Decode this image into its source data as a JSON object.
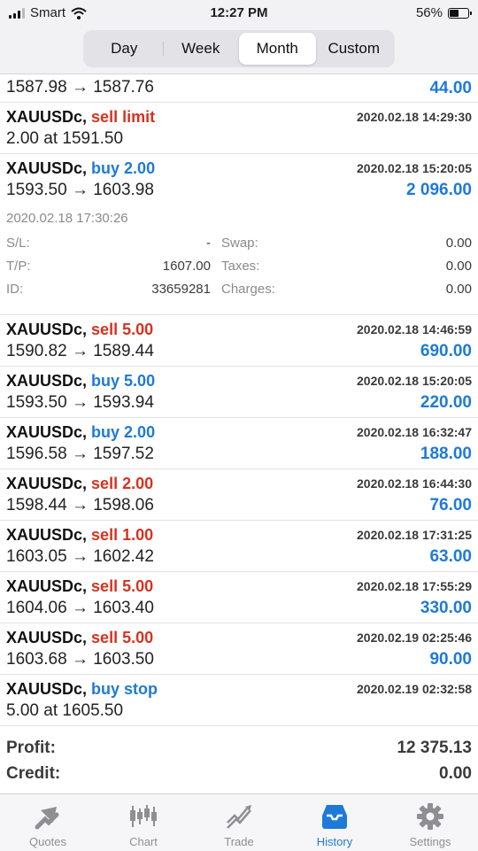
{
  "status_bar": {
    "carrier": "Smart",
    "time": "12:27 PM",
    "battery": "56%",
    "battery_level": 0.56
  },
  "period_tabs": [
    {
      "label": "Day",
      "active": false
    },
    {
      "label": "Week",
      "active": false
    },
    {
      "label": "Month",
      "active": true
    },
    {
      "label": "Custom",
      "active": false
    }
  ],
  "top_row": {
    "prices": "1587.98 → 1587.76",
    "profit": "44.00"
  },
  "orders": [
    {
      "symbol": "XAUUSDc,",
      "side": "sell limit",
      "dir": "sell",
      "time": "2020.02.18 14:29:30",
      "line2": "2.00 at 1591.50",
      "profit": ""
    },
    {
      "symbol": "XAUUSDc,",
      "side": "buy 2.00",
      "dir": "buy",
      "time": "2020.02.18 15:20:05",
      "line2": "1593.50 → 1603.98",
      "profit": "2 096.00"
    }
  ],
  "expanded": {
    "close_time": "2020.02.18 17:30:26",
    "sl_label": "S/L:",
    "sl_value": "-",
    "swap_label": "Swap:",
    "swap_value": "0.00",
    "tp_label": "T/P:",
    "tp_value": "1607.00",
    "taxes_label": "Taxes:",
    "taxes_value": "0.00",
    "id_label": "ID:",
    "id_value": "33659281",
    "charges_label": "Charges:",
    "charges_value": "0.00"
  },
  "deals": [
    {
      "symbol": "XAUUSDc,",
      "side": "sell 5.00",
      "dir": "sell",
      "time": "2020.02.18 14:46:59",
      "line2": "1590.82 → 1589.44",
      "profit": "690.00"
    },
    {
      "symbol": "XAUUSDc,",
      "side": "buy 5.00",
      "dir": "buy",
      "time": "2020.02.18 15:20:05",
      "line2": "1593.50 → 1593.94",
      "profit": "220.00"
    },
    {
      "symbol": "XAUUSDc,",
      "side": "buy 2.00",
      "dir": "buy",
      "time": "2020.02.18 16:32:47",
      "line2": "1596.58 → 1597.52",
      "profit": "188.00"
    },
    {
      "symbol": "XAUUSDc,",
      "side": "sell 2.00",
      "dir": "sell",
      "time": "2020.02.18 16:44:30",
      "line2": "1598.44 → 1598.06",
      "profit": "76.00"
    },
    {
      "symbol": "XAUUSDc,",
      "side": "sell 1.00",
      "dir": "sell",
      "time": "2020.02.18 17:31:25",
      "line2": "1603.05 → 1602.42",
      "profit": "63.00"
    },
    {
      "symbol": "XAUUSDc,",
      "side": "sell 5.00",
      "dir": "sell",
      "time": "2020.02.18 17:55:29",
      "line2": "1604.06 → 1603.40",
      "profit": "330.00"
    },
    {
      "symbol": "XAUUSDc,",
      "side": "sell 5.00",
      "dir": "sell",
      "time": "2020.02.19 02:25:46",
      "line2": "1603.68 → 1603.50",
      "profit": "90.00"
    },
    {
      "symbol": "XAUUSDc,",
      "side": "buy stop",
      "dir": "buy",
      "time": "2020.02.19 02:32:58",
      "line2": "5.00 at 1605.50",
      "profit": ""
    }
  ],
  "summary": {
    "profit_label": "Profit:",
    "profit_value": "12 375.13",
    "credit_label": "Credit:",
    "credit_value": "0.00"
  },
  "tabbar": [
    {
      "label": "Quotes",
      "icon": "quotes-icon",
      "active": false
    },
    {
      "label": "Chart",
      "icon": "chart-icon",
      "active": false
    },
    {
      "label": "Trade",
      "icon": "trade-icon",
      "active": false
    },
    {
      "label": "History",
      "icon": "history-icon",
      "active": true
    },
    {
      "label": "Settings",
      "icon": "gear-icon",
      "active": false
    }
  ],
  "colors": {
    "sell": "#d6321e",
    "buy": "#1e7ad6",
    "profit": "#1e7ad6",
    "tab_active": "#1e7ad6",
    "tab_inactive": "#8e8e93"
  }
}
